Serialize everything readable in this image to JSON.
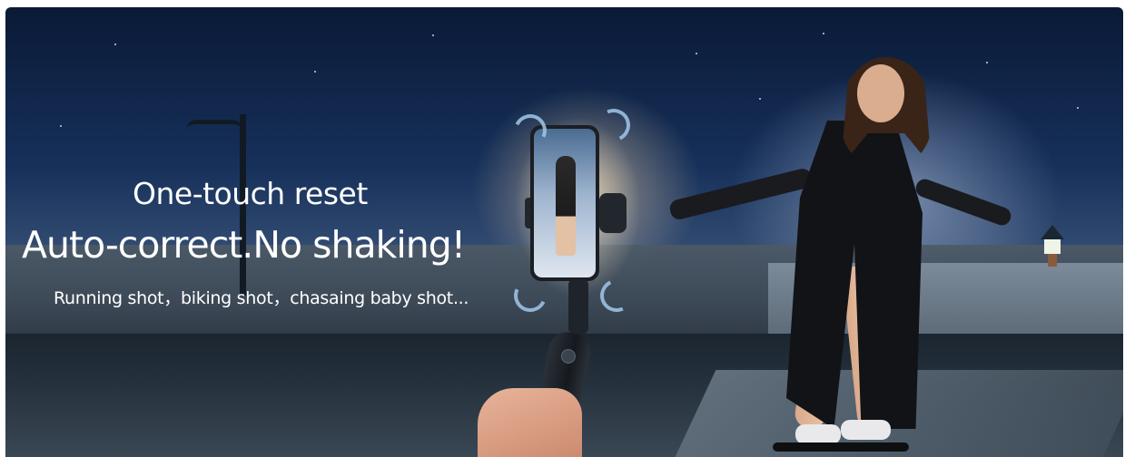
{
  "banner": {
    "headline_small": "One-touch reset",
    "headline_large": "Auto-correct.No shaking!",
    "subline": "Running shot，biking shot，chasaing baby shot..."
  },
  "colors": {
    "text": "#ffffff",
    "sky_top": "#0a1a36",
    "sky_mid": "#3b5479",
    "accent_arrows": "#a0c8eb"
  },
  "icons": [
    "rotate-arrow-icon"
  ]
}
